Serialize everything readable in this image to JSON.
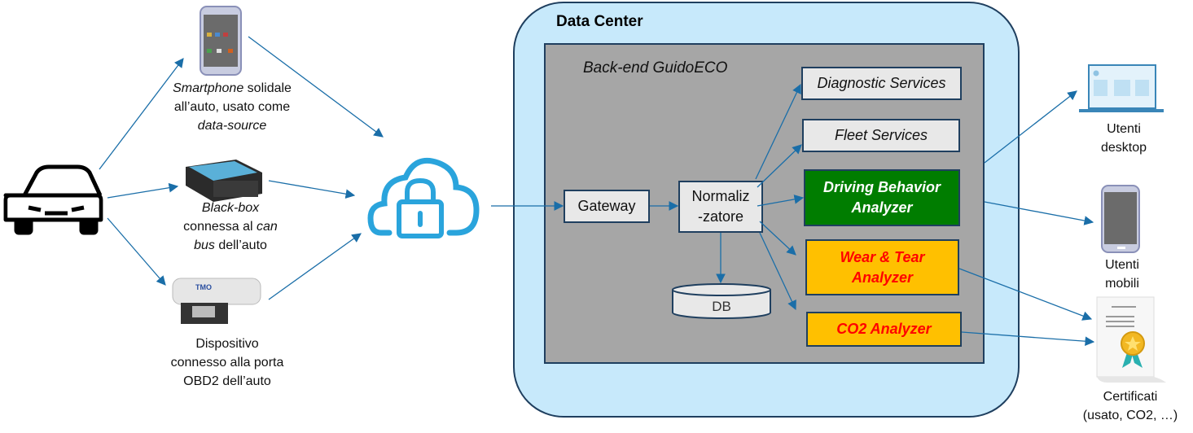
{
  "data_center": {
    "title": "Data Center",
    "backend_title": "Back-end GuidoECO"
  },
  "nodes": {
    "gateway": "Gateway",
    "normalizer_line1": "Normaliz",
    "normalizer_line2": "-zatore",
    "db": "DB",
    "diagnostic": "Diagnostic Services",
    "fleet": "Fleet Services",
    "driving_line1": "Driving Behavior",
    "driving_line2": "Analyzer",
    "wear_line1": "Wear & Tear",
    "wear_line2": "Analyzer",
    "co2": "CO2 Analyzer"
  },
  "sources": {
    "smartphone": {
      "em": "Smartphone",
      "l1": " solidale",
      "l2": "all’auto, usato come",
      "l3": "data-source"
    },
    "blackbox": {
      "l1": "Black-box",
      "l2": "connessa al ",
      "l2em": "can",
      "l3em": "bus",
      "l3": " dell’auto"
    },
    "obd": {
      "l1": "Dispositivo",
      "l2": "connesso alla porta",
      "l3": "OBD2 dell’auto"
    }
  },
  "consumers": {
    "desktop": {
      "l1": "Utenti",
      "l2": "desktop"
    },
    "mobile": {
      "l1": "Utenti",
      "l2": "mobili"
    },
    "certificates": {
      "l1": "Certificati",
      "l2": "(usato, CO2, …)"
    }
  },
  "colors": {
    "arrow": "#1a6ea8",
    "datacenter": "#c7e9fb",
    "backend": "#a6a6a6",
    "green": "#007d00",
    "orange": "#ffc000",
    "red_text": "#ff0000"
  }
}
